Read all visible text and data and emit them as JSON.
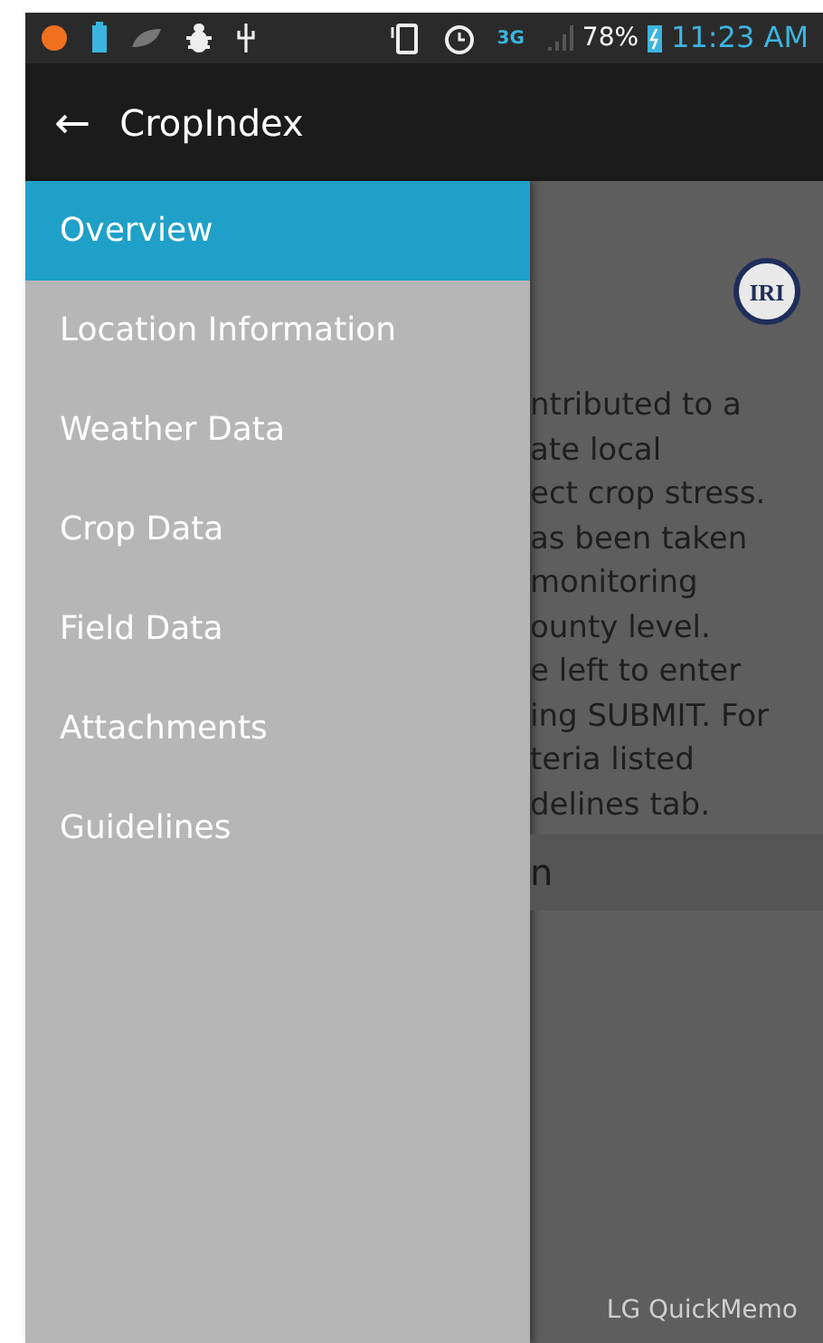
{
  "status_bar": {
    "network": "3G",
    "battery": "78%",
    "time": "11:23 AM"
  },
  "app_bar": {
    "back": "←",
    "title": "CropIndex"
  },
  "drawer": {
    "items": [
      {
        "label": "Overview",
        "selected": true
      },
      {
        "label": "Location Information",
        "selected": false
      },
      {
        "label": "Weather Data",
        "selected": false
      },
      {
        "label": "Crop Data",
        "selected": false
      },
      {
        "label": "Field Data",
        "selected": false
      },
      {
        "label": "Attachments",
        "selected": false
      },
      {
        "label": "Guidelines",
        "selected": false
      }
    ]
  },
  "content": {
    "lines": [
      "ntributed to a",
      "ate local",
      "ect crop stress.",
      "as been taken",
      "monitoring",
      "ounty level.",
      "e left to enter",
      "ing SUBMIT. For",
      "teria listed",
      "delines tab."
    ],
    "button": "n"
  },
  "logo": "IRI",
  "overlay_label": "LG QuickMemo"
}
